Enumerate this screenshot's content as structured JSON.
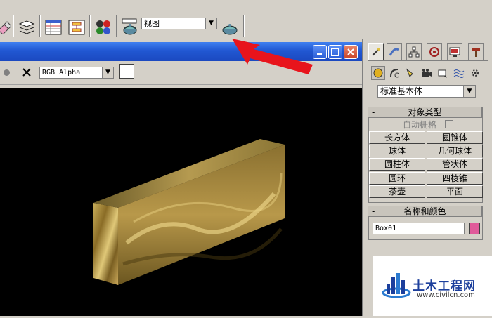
{
  "toolbar": {
    "view_dropdown_value": "视图",
    "icons": [
      "eraser-icon",
      "layers-icon",
      "table-icon",
      "schematic-icon",
      "material-editor-icon",
      "render-setup-icon",
      "quick-render-icon"
    ]
  },
  "viewport": {
    "channel_dropdown_value": "RGB Alpha",
    "swatch_color": "#ffffff",
    "background_color": "#000000"
  },
  "command_panel": {
    "tabs": [
      "create-tab",
      "modify-tab",
      "hierarchy-tab",
      "motion-tab",
      "display-tab",
      "utilities-tab"
    ],
    "subtabs": [
      "geometry",
      "shapes",
      "lights",
      "cameras",
      "helpers",
      "spacewarps",
      "systems"
    ],
    "primitive_dropdown_value": "标准基本体",
    "object_type": {
      "header": "对象类型",
      "collapse_symbol": "-",
      "autogrid_label": "自动栅格",
      "buttons": [
        "长方体",
        "圆锥体",
        "球体",
        "几何球体",
        "圆柱体",
        "管状体",
        "圆环",
        "四棱锥",
        "茶壶",
        "平面"
      ]
    },
    "name_color": {
      "header": "名称和颜色",
      "collapse_symbol": "-",
      "name_value": "Box01",
      "color": "#e05a9a"
    }
  },
  "watermark": {
    "brand": "土木工程网",
    "url": "www.civilcn.com"
  },
  "annotation": {
    "arrow_color": "#e8141c"
  }
}
